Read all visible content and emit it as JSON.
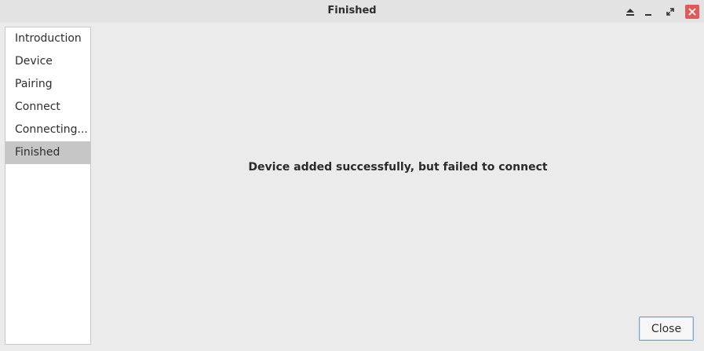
{
  "window": {
    "title": "Finished",
    "controls": {
      "shade_icon": "eject-icon",
      "minimize_icon": "minimize-icon",
      "maximize_icon": "maximize-icon",
      "close_icon": "close-icon",
      "close_color": "#e05a5a"
    }
  },
  "sidebar": {
    "items": [
      {
        "label": "Introduction"
      },
      {
        "label": "Device"
      },
      {
        "label": "Pairing"
      },
      {
        "label": "Connect"
      },
      {
        "label": "Connecting..."
      },
      {
        "label": "Finished",
        "active": true
      }
    ]
  },
  "main": {
    "message": "Device added successfully, but failed to connect"
  },
  "footer": {
    "close_label": "Close"
  }
}
